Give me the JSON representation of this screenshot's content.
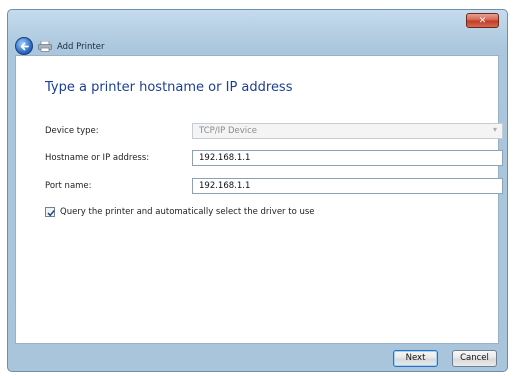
{
  "window": {
    "close_glyph": "✕"
  },
  "header": {
    "title": "Add Printer",
    "back_icon": "back-arrow-icon",
    "printer_icon": "printer-icon"
  },
  "main": {
    "heading": "Type a printer hostname or IP address",
    "device_type": {
      "label": "Device type:",
      "value": "TCP/IP Device"
    },
    "hostname": {
      "label": "Hostname or IP address:",
      "value": "192.168.1.1"
    },
    "port_name": {
      "label": "Port name:",
      "value": "192.168.1.1"
    },
    "query_checkbox": {
      "label": "Query the printer and automatically select the driver to use",
      "checked": true
    }
  },
  "footer": {
    "next_label": "Next",
    "cancel_label": "Cancel"
  }
}
